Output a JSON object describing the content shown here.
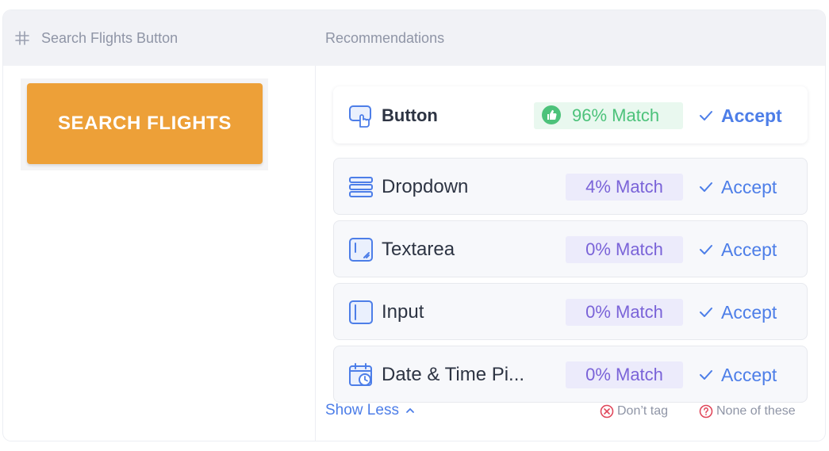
{
  "header": {
    "element_name": "Search Flights Button",
    "recommendations_title": "Recommendations"
  },
  "preview": {
    "button_text": "SEARCH FLIGHTS"
  },
  "recommendations": [
    {
      "label": "Button",
      "match": "96% Match",
      "accept": "Accept",
      "icon": "button-pointer-icon",
      "top": true
    },
    {
      "label": "Dropdown",
      "match": "4% Match",
      "accept": "Accept",
      "icon": "dropdown-icon",
      "top": false
    },
    {
      "label": "Textarea",
      "match": "0% Match",
      "accept": "Accept",
      "icon": "textarea-icon",
      "top": false
    },
    {
      "label": "Input",
      "match": "0% Match",
      "accept": "Accept",
      "icon": "input-icon",
      "top": false
    },
    {
      "label": "Date & Time Pi...",
      "match": "0% Match",
      "accept": "Accept",
      "icon": "calendar-clock-icon",
      "top": false
    }
  ],
  "footer": {
    "show_less": "Show Less",
    "dont_tag": "Don’t tag",
    "none_of_these": "None of these"
  },
  "colors": {
    "accent": "#4d7ee8",
    "preview_button": "#eda038",
    "match_good": "#4cc27a",
    "match_other": "#7a63d8",
    "danger": "#e0475b"
  }
}
